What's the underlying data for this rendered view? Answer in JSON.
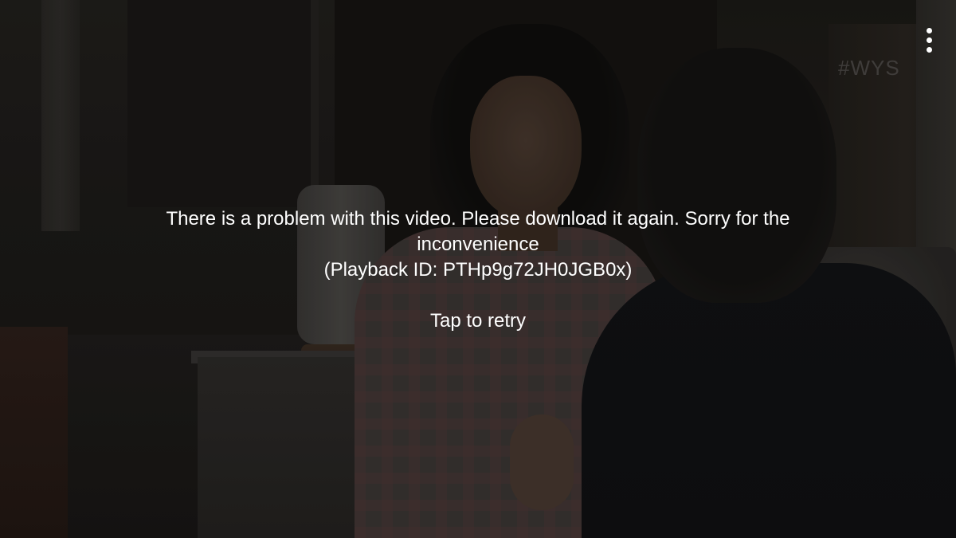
{
  "player": {
    "menu_icon": "more-vert-icon",
    "watermark": "#WYS"
  },
  "error": {
    "message": "There is a problem with this video. Please download it again. Sorry for the inconvenience",
    "playback_id": "(Playback ID: PTHp9g72JH0JGB0x)",
    "retry_label": "Tap to retry"
  },
  "colors": {
    "text": "#ffffff",
    "background": "#161412"
  }
}
